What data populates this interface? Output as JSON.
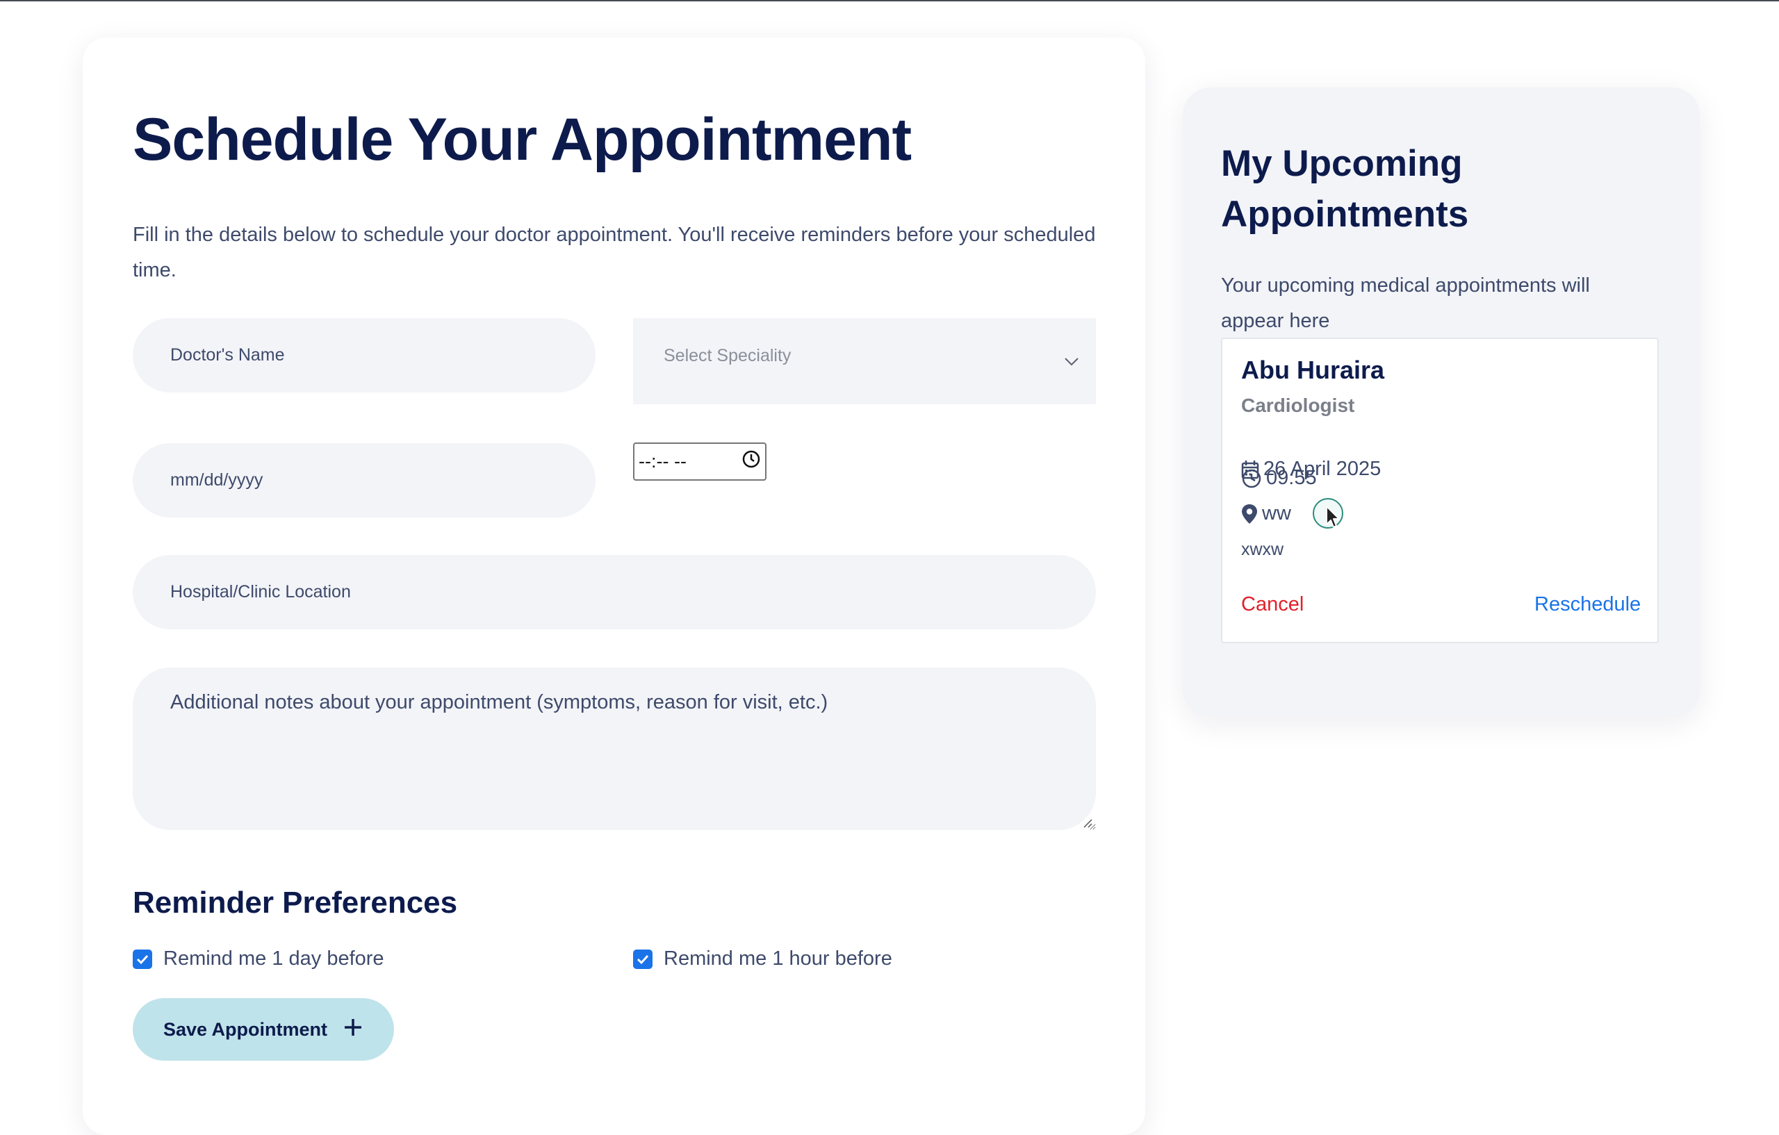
{
  "form": {
    "title": "Schedule Your Appointment",
    "intro": "Fill in the details below to schedule your doctor appointment. You'll receive reminders before your scheduled time.",
    "doctor_placeholder": "Doctor's Name",
    "speciality_placeholder": "Select Speciality",
    "date_placeholder": "mm/dd/yyyy",
    "time_value": "--:-- --",
    "location_placeholder": "Hospital/Clinic Location",
    "notes_placeholder": "Additional notes about your appointment (symptoms, reason for visit, etc.)"
  },
  "reminders": {
    "title": "Reminder Preferences",
    "options": [
      {
        "label": "Remind me 1 day before",
        "checked": true
      },
      {
        "label": "Remind me 1 hour before",
        "checked": true
      }
    ]
  },
  "save_button": {
    "label": "Save Appointment",
    "icon": "plus-icon"
  },
  "upcoming": {
    "title": "My Upcoming Appointments",
    "subtitle": "Your upcoming medical appointments will appear here",
    "appointment": {
      "doctor": "Abu Huraira",
      "speciality": "Cardiologist",
      "date": "26 April 2025",
      "time": "09:55",
      "location": "ww",
      "notes": "xwxw",
      "cancel_label": "Cancel",
      "reschedule_label": "Reschedule"
    }
  },
  "colors": {
    "heading": "#0d1b4c",
    "body_text": "#3e4a6b",
    "field_bg": "#f3f4f8",
    "save_button_bg": "#bfe3ea",
    "checkbox": "#1a73e8",
    "cancel": "#e0202a",
    "reschedule": "#1a73e8"
  }
}
